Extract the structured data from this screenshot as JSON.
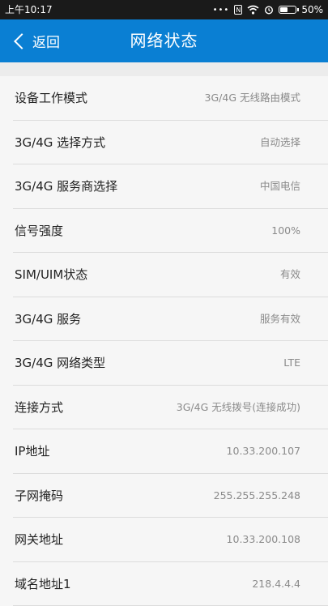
{
  "status_bar": {
    "time": "上午10:17",
    "dots": "•••",
    "nfc": "N",
    "battery_percent": "50%",
    "battery_level": 0.5
  },
  "header": {
    "back_label": "返回",
    "title": "网络状态"
  },
  "rows": [
    {
      "label": "设备工作模式",
      "value": "3G/4G 无线路由模式"
    },
    {
      "label": "3G/4G 选择方式",
      "value": "自动选择"
    },
    {
      "label": "3G/4G 服务商选择",
      "value": "中国电信"
    },
    {
      "label": "信号强度",
      "value": "100%"
    },
    {
      "label": "SIM/UIM状态",
      "value": "有效"
    },
    {
      "label": "3G/4G 服务",
      "value": "服务有效"
    },
    {
      "label": "3G/4G 网络类型",
      "value": "LTE"
    },
    {
      "label": "连接方式",
      "value": "3G/4G 无线拨号(连接成功)"
    },
    {
      "label": "IP地址",
      "value": "10.33.200.107"
    },
    {
      "label": "子网掩码",
      "value": "255.255.255.248"
    },
    {
      "label": "网关地址",
      "value": "10.33.200.108"
    },
    {
      "label": "域名地址1",
      "value": "218.4.4.4"
    }
  ]
}
